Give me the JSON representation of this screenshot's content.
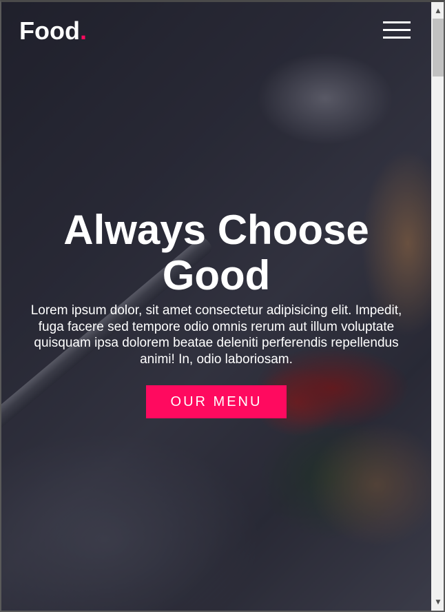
{
  "brand": {
    "name": "Food",
    "dot": "."
  },
  "nav": {
    "menu_icon": "hamburger-menu-icon"
  },
  "hero": {
    "title": "Always Choose Good",
    "text": "Lorem ipsum dolor, sit amet consectetur adipisicing elit. Impedit, fuga facere sed tempore odio omnis rerum aut illum voluptate quisquam ipsa dolorem beatae deleniti perferendis repellendus animi! In, odio laboriosam.",
    "cta_label": "Our Menu",
    "background_image": "pasta-with-tomatoes-photo"
  },
  "scrollbar": {
    "up_icon": "scroll-up-arrow-icon",
    "down_icon": "scroll-down-arrow-icon"
  },
  "colors": {
    "accent": "#ff0a5f",
    "text": "#ffffff"
  }
}
